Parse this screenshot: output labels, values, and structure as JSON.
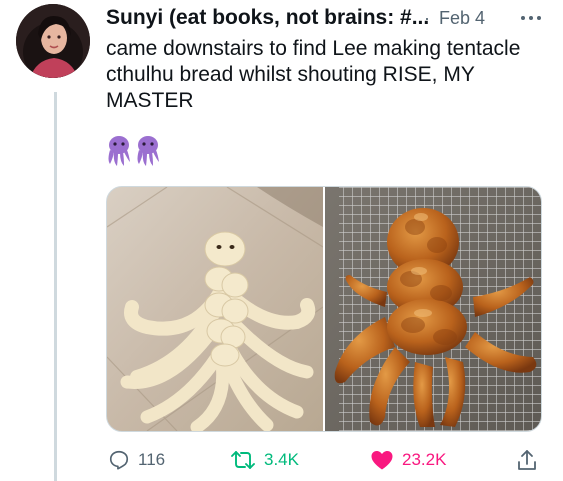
{
  "tweet": {
    "author_name": "Sunyi (eat books, not brains: #...",
    "separator": "·",
    "date": "Feb 4",
    "text_lines": [
      "came downstairs to find Lee making tentacle",
      "cthulhu bread whilst shouting RISE, MY",
      "MASTER"
    ],
    "emoji": [
      "octopus-emoji",
      "octopus-emoji"
    ]
  },
  "media": [
    {
      "icon": "raw-braided-dough-octopus-photo"
    },
    {
      "icon": "baked-octopus-bread-photo"
    }
  ],
  "actions": {
    "replies": "116",
    "retweets": "3.4K",
    "likes": "23.2K"
  },
  "colors": {
    "text": "#0f1419",
    "muted": "#536471",
    "retweet": "#00ba7c",
    "like": "#f91880",
    "emoji": "#9b6fd0"
  }
}
